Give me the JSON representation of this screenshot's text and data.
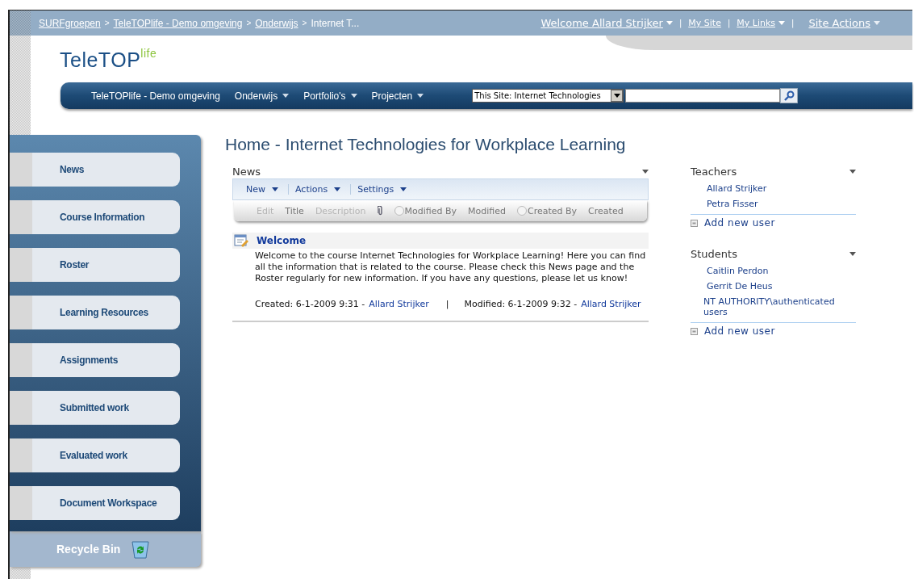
{
  "breadcrumb_separator": ">",
  "breadcrumb": [
    {
      "label": "SURFgroepen",
      "link": true
    },
    {
      "label": "TeleTOPlife - Demo omgeving",
      "link": true
    },
    {
      "label": "Onderwijs",
      "link": true
    },
    {
      "label": "Internet T...",
      "link": false
    }
  ],
  "user_menu": {
    "separator": "|",
    "welcome": "Welcome Allard Strijker",
    "links": [
      {
        "label": "My Site",
        "dropdown": false
      },
      {
        "label": "My Links",
        "dropdown": true
      }
    ],
    "site_actions": "Site Actions"
  },
  "logo": {
    "text": "TeleTOP",
    "suffix": "life"
  },
  "nav": {
    "items": [
      {
        "label": "TeleTOPlife - Demo omgeving",
        "dropdown": false
      },
      {
        "label": "Onderwijs",
        "dropdown": true
      },
      {
        "label": "Portfolio's",
        "dropdown": true
      },
      {
        "label": "Projecten",
        "dropdown": true
      }
    ],
    "search_scope": "This Site: Internet Technologies"
  },
  "sidebar": {
    "items": [
      "News",
      "Course Information",
      "Roster",
      "Learning Resources",
      "Assignments",
      "Submitted work",
      "Evaluated work",
      "Document Workspace"
    ],
    "recycle_bin": "Recycle Bin"
  },
  "page_title": "Home - Internet Technologies for Workplace Learning",
  "news": {
    "title": "News",
    "toolbar": [
      "New",
      "Actions",
      "Settings"
    ],
    "columns": [
      {
        "kind": "text",
        "label": "Edit",
        "disabled": true
      },
      {
        "kind": "text",
        "label": "Title",
        "disabled": false
      },
      {
        "kind": "text",
        "label": "Description",
        "disabled": true
      },
      {
        "kind": "icon",
        "disabled": false
      },
      {
        "kind": "radio",
        "label": "Modified By",
        "disabled": false
      },
      {
        "kind": "text",
        "label": "Modified",
        "disabled": false
      },
      {
        "kind": "radio",
        "label": "Created By",
        "disabled": false
      },
      {
        "kind": "text",
        "label": "Created",
        "disabled": false
      }
    ],
    "items": [
      {
        "title": "Welcome",
        "body": "Welcome to the course Internet Technologies for Workplace Learning! Here you can find all the information that is related to the course. Please check this News page and the Roster regularly for new information. If you have any questions, please let us know!",
        "created": "Created: 6-1-2009 9:31 -",
        "created_by": "Allard Strijker",
        "separator": "|",
        "modified": "Modified: 6-1-2009 9:32 -",
        "modified_by": "Allard Strijker"
      }
    ]
  },
  "groups": [
    {
      "title": "Teachers",
      "members": [
        "Allard Strijker",
        "Petra Fisser"
      ],
      "add": "Add new user"
    },
    {
      "title": "Students",
      "members": [
        "Caitlin Perdon",
        "Gerrit De Heus",
        "NT AUTHORITY\\authenticated users"
      ],
      "add": "Add new user"
    }
  ]
}
